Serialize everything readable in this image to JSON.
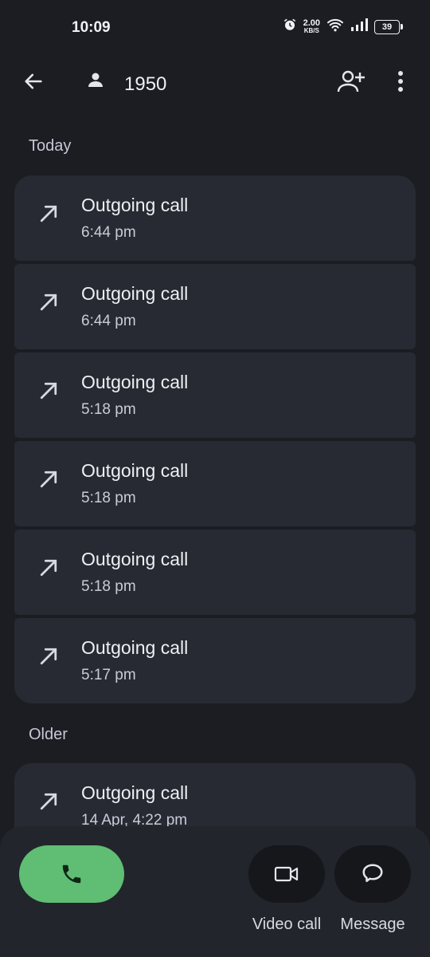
{
  "status_bar": {
    "time": "10:09",
    "net_speed_value": "2.00",
    "net_speed_unit": "KB/S",
    "battery": "39"
  },
  "app_bar": {
    "contact_name": "1950"
  },
  "sections": {
    "today_label": "Today",
    "older_label": "Older"
  },
  "calls_today": [
    {
      "type": "Outgoing call",
      "time": "6:44 pm"
    },
    {
      "type": "Outgoing call",
      "time": "6:44 pm"
    },
    {
      "type": "Outgoing call",
      "time": "5:18 pm"
    },
    {
      "type": "Outgoing call",
      "time": "5:18 pm"
    },
    {
      "type": "Outgoing call",
      "time": "5:18 pm"
    },
    {
      "type": "Outgoing call",
      "time": "5:17 pm"
    }
  ],
  "calls_older": [
    {
      "type": "Outgoing call",
      "time": "14 Apr, 4:22 pm"
    }
  ],
  "actions": {
    "video_call_label": "Video call",
    "message_label": "Message"
  },
  "icons": {
    "back": "arrow-left-icon",
    "contact": "person-icon",
    "add_contact": "person-add-icon",
    "more": "more-vert-icon",
    "call_direction": "arrow-up-right-icon",
    "call": "phone-icon",
    "video": "video-camera-icon",
    "message": "chat-bubble-icon"
  },
  "colors": {
    "background": "#1b1d22",
    "card": "#272a32",
    "call_button": "#5fbe73"
  }
}
